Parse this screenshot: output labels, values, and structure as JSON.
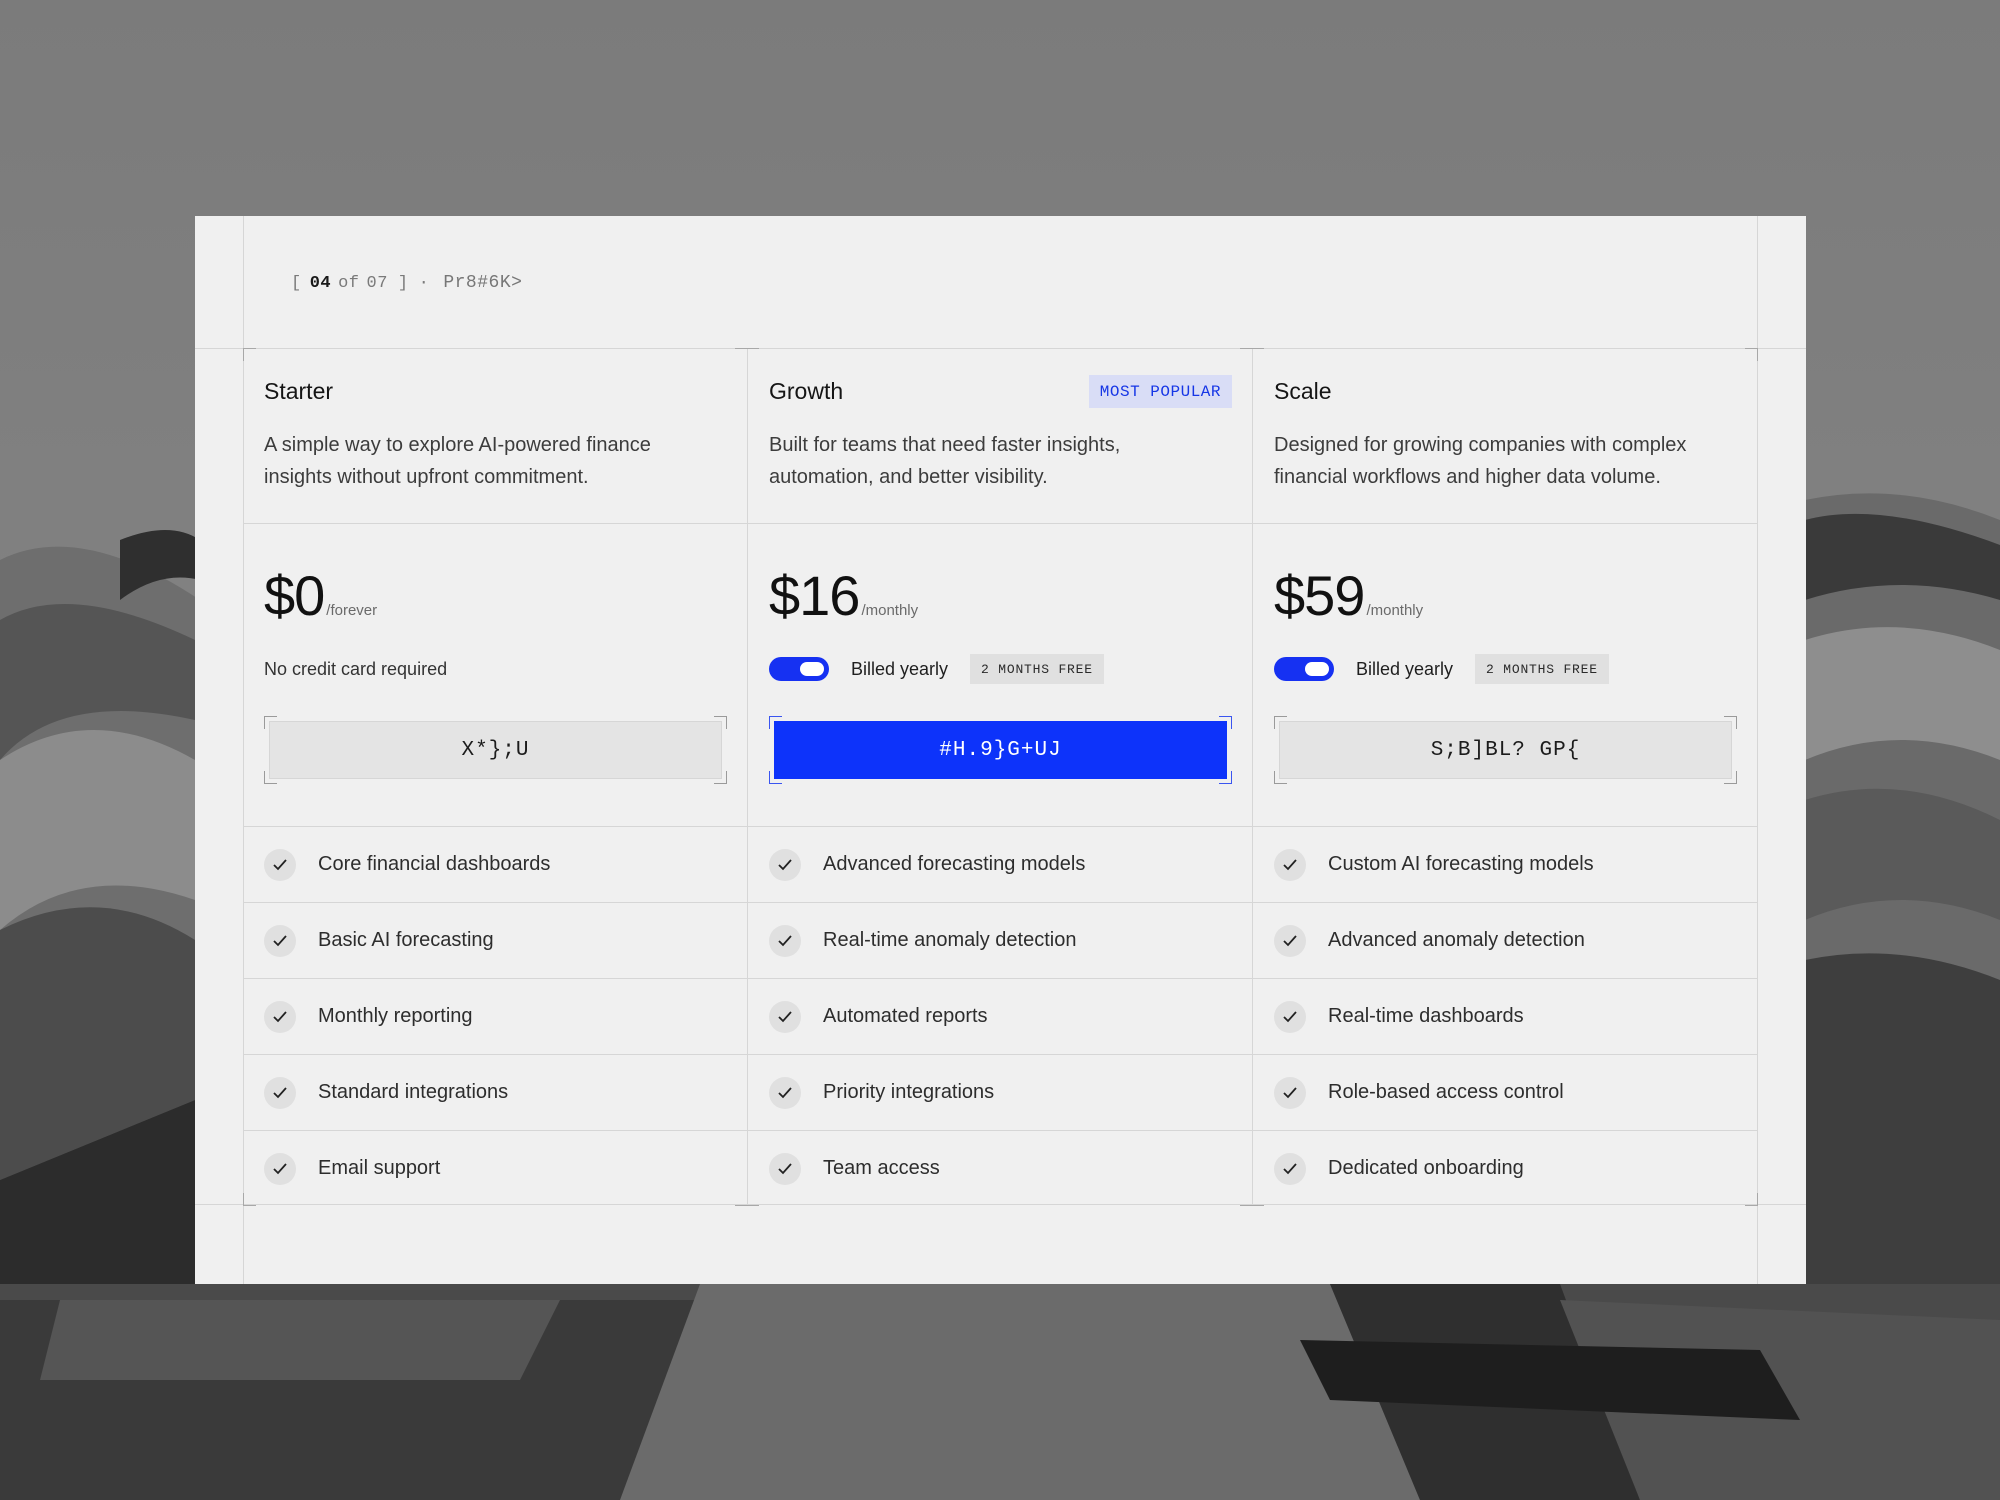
{
  "pager": {
    "bracket_open": "[",
    "current": "04",
    "of": "of",
    "total": "07",
    "bracket_close": "]",
    "dot": "·",
    "code": "Pr8#6K>"
  },
  "colors": {
    "accent": "#0d33fa",
    "badge_bg": "#d9ddf6",
    "card_bg": "#f0f0f0"
  },
  "plans": [
    {
      "name": "Starter",
      "badge": "",
      "description": "A simple way to explore AI-powered finance insights without upfront commitment.",
      "price": "$0",
      "period": "/forever",
      "note": "No credit card required",
      "cta": "X*};U",
      "features": [
        "Core financial dashboards",
        "Basic AI forecasting",
        "Monthly reporting",
        "Standard integrations",
        "Email support"
      ]
    },
    {
      "name": "Growth",
      "badge": "MOST POPULAR",
      "description": "Built for teams that need faster insights, automation, and better visibility.",
      "price": "$16",
      "period": "/monthly",
      "billing_label": "Billed yearly",
      "billing_yearly_on": true,
      "free_badge": "2 MONTHS FREE",
      "cta": "#H.9}G+UJ",
      "features": [
        "Advanced forecasting models",
        "Real-time anomaly detection",
        "Automated reports",
        "Priority integrations",
        "Team access"
      ]
    },
    {
      "name": "Scale",
      "badge": "",
      "description": "Designed for growing companies with complex financial workflows and higher data volume.",
      "price": "$59",
      "period": "/monthly",
      "billing_label": "Billed yearly",
      "billing_yearly_on": true,
      "free_badge": "2 MONTHS FREE",
      "cta": "S;B]BL? GP{",
      "features": [
        "Custom AI forecasting models",
        "Advanced anomaly detection",
        "Real-time dashboards",
        "Role-based access control",
        "Dedicated onboarding"
      ]
    }
  ],
  "icons": {
    "feature_check": "check-icon",
    "billing_toggle": "toggle-switch"
  }
}
